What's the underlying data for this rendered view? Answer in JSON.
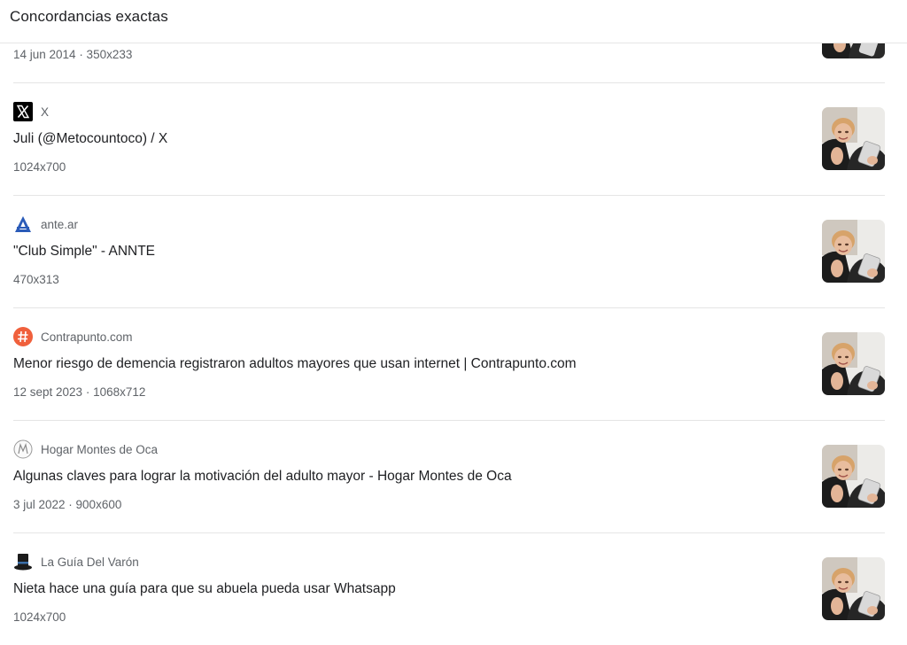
{
  "header": {
    "title": "Concordancias exactas"
  },
  "partial_top": {
    "meta": "14 jun 2014 · 350x233"
  },
  "results": [
    {
      "source": "X",
      "favicon": "x-logo-icon",
      "title": "Juli (@Metocountoco) / X",
      "meta": "1024x700"
    },
    {
      "source": "ante.ar",
      "favicon": "ante-logo-icon",
      "title": "\"Club Simple\" - ANNTE",
      "meta": "470x313"
    },
    {
      "source": "Contrapunto.com",
      "favicon": "hash-logo-icon",
      "title": "Menor riesgo de demencia registraron adultos mayores que usan internet | Contrapunto.com",
      "meta": "12 sept 2023 · 1068x712"
    },
    {
      "source": "Hogar Montes de Oca",
      "favicon": "hogar-logo-icon",
      "title": "Algunas claves para lograr la motivación del adulto mayor - Hogar Montes de Oca",
      "meta": "3 jul 2022 · 900x600"
    },
    {
      "source": "La Guía Del Varón",
      "favicon": "top-hat-icon",
      "title": "Nieta hace una guía para que su abuela pueda usar Whatsapp",
      "meta": "1024x700"
    }
  ]
}
